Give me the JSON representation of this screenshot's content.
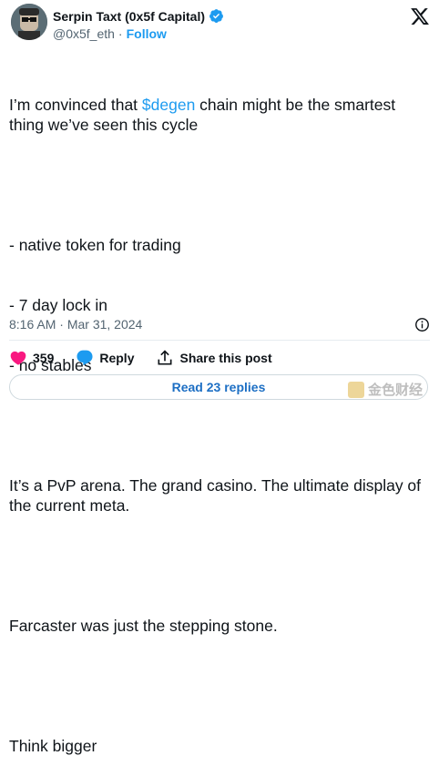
{
  "author": {
    "display_name": "Serpin Taxt (0x5f Capital)",
    "handle": "@0x5f_eth",
    "separator": "·",
    "follow_label": "Follow"
  },
  "tweet": {
    "line1_pre": "I’m convinced that ",
    "cashtag": "$degen",
    "line1_post": " chain might be the smartest thing we’ve seen this cycle",
    "list": [
      "- native token for trading",
      "- 7 day lock in",
      "- no stables"
    ],
    "para2": "It’s a PvP arena. The grand casino. The ultimate display of the current meta.",
    "para3": "Farcaster was just the stepping stone.",
    "para4": "Think bigger"
  },
  "meta": {
    "time": "8:16 AM",
    "separator": "·",
    "date": "Mar 31, 2024"
  },
  "actions": {
    "like_count": "359",
    "reply_label": "Reply",
    "share_label": "Share this post"
  },
  "read_replies_label": "Read 23 replies",
  "watermark_text": "金色财经",
  "colors": {
    "link": "#1d9bf0",
    "like": "#f91880",
    "secondary_text": "#536471"
  }
}
